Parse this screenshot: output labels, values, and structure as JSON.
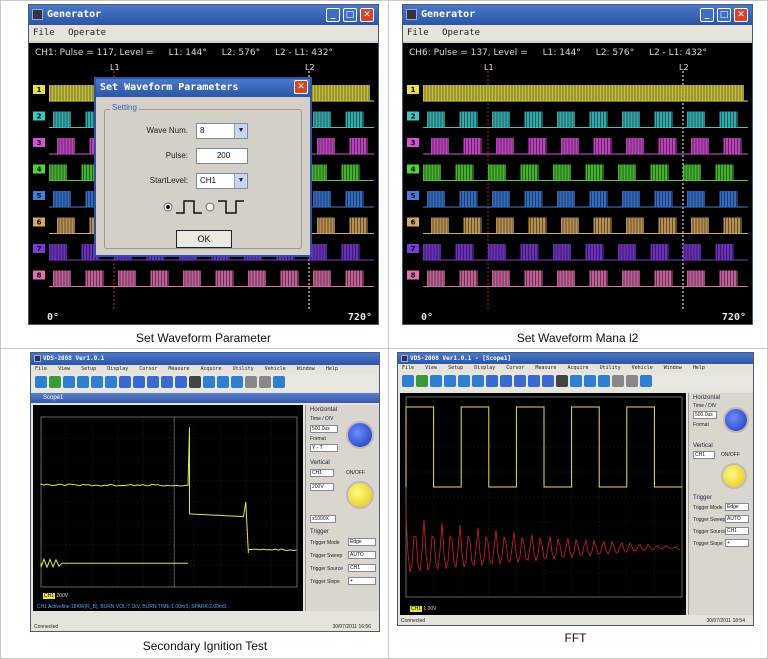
{
  "captions": {
    "tl": "Set Waveform Parameter",
    "tr": "Set Waveform Mana l2",
    "bl": "Secondary Ignition Test",
    "br": "FFT"
  },
  "win1": {
    "title": "Generator",
    "menu": [
      "File",
      "Operate"
    ],
    "status": "CH1: Pulse = 117, Level =",
    "l1": "L1: 144°",
    "l2": "L2: 576°",
    "diff": "L2 - L1: 432°",
    "deg_start": "0°",
    "deg_end": "720°",
    "channels": [
      "1",
      "2",
      "3",
      "4",
      "5",
      "6",
      "7",
      "8"
    ],
    "marker_l1": "L1",
    "marker_l2": "L2"
  },
  "dialog": {
    "title": "Set Waveform Parameters",
    "group": "Setting",
    "wave_num_label": "Wave Num.",
    "wave_num_value": "8",
    "pulse_label": "Pulse:",
    "pulse_value": "200",
    "start_label": "StartLevel:",
    "start_value": "CH1",
    "ok": "OK"
  },
  "win2": {
    "title": "Generator",
    "menu": [
      "File",
      "Operate"
    ],
    "status": "CH6: Pulse = 137, Level =",
    "l1": "L1: 144°",
    "l2": "L2: 576°",
    "diff": "L2 - L1: 432°",
    "deg_start": "0°",
    "deg_end": "720°",
    "channels": [
      "1",
      "2",
      "3",
      "4",
      "5",
      "6",
      "7",
      "8"
    ],
    "marker_l1": "L1",
    "marker_l2": "L2"
  },
  "win3": {
    "title": "VDS-2008 Ver1.0.1",
    "menu": [
      "File",
      "View",
      "Setup",
      "Display",
      "Cursor",
      "Measure",
      "Acquire",
      "Utility",
      "Vehicle",
      "Window",
      "Help"
    ],
    "subtitle": "Scope1",
    "status_left": "Connected",
    "status_right": "30/07/2011  16:56",
    "info": "CH1 Activeline 18KW(R_B), BURN VOL:7.1kV, BURN TIME:1.00mS, SPARK:2.00mS",
    "ch_tag": "CH1",
    "ch_scale": "200V",
    "panel": {
      "horizontal": "Horizontal",
      "time_div": "Time / DIV",
      "time_val": "500.0us",
      "format": "Format",
      "format_val": "Y - T",
      "vertical": "Vertical",
      "ch_sel": "CH1",
      "onoff": "ON/OFF",
      "volt": "200V",
      "probe": "x1000X",
      "trigger": "Trigger",
      "trig_mode": "Trigger Mode",
      "trig_mode_val": "Edge",
      "trig_sweep": "Trigger Sweep",
      "trig_sweep_val": "AUTO",
      "trig_source": "Trigger Source",
      "trig_source_val": "CH1",
      "trig_slope": "Trigger Slope",
      "trig_slope_val": "+"
    }
  },
  "win4": {
    "title": "VDS-2008 Ver1.0.1 - [Scope1]",
    "menu": [
      "File",
      "View",
      "Setup",
      "Display",
      "Cursor",
      "Measure",
      "Acquire",
      "Utility",
      "Vehicle",
      "Window",
      "Help"
    ],
    "status_left": "Connected",
    "status_right": "30/07/2011  18:54",
    "ch_tag": "CH1",
    "ch_scale": "1.00V",
    "panel": {
      "horizontal": "Horizontal",
      "time_div": "Time / DIV",
      "time_val": "500.0us",
      "format": "Format",
      "vertical": "Vertical",
      "ch_sel": "CH1",
      "onoff": "ON/OFF",
      "trigger": "Trigger",
      "trig_mode": "Trigger Mode",
      "trig_mode_val": "Edge",
      "trig_sweep": "Trigger Sweep",
      "trig_sweep_val": "AUTO",
      "trig_source": "Trigger Source",
      "trig_source_val": "CH1",
      "trig_slope": "Trigger Slope",
      "trig_slope_val": "+"
    }
  },
  "colors": {
    "ch": [
      "#e6e04a",
      "#3ec6c6",
      "#d84fd8",
      "#52d03a",
      "#3d7ee0",
      "#d8a860",
      "#7a3ad8",
      "#e070b0"
    ]
  }
}
